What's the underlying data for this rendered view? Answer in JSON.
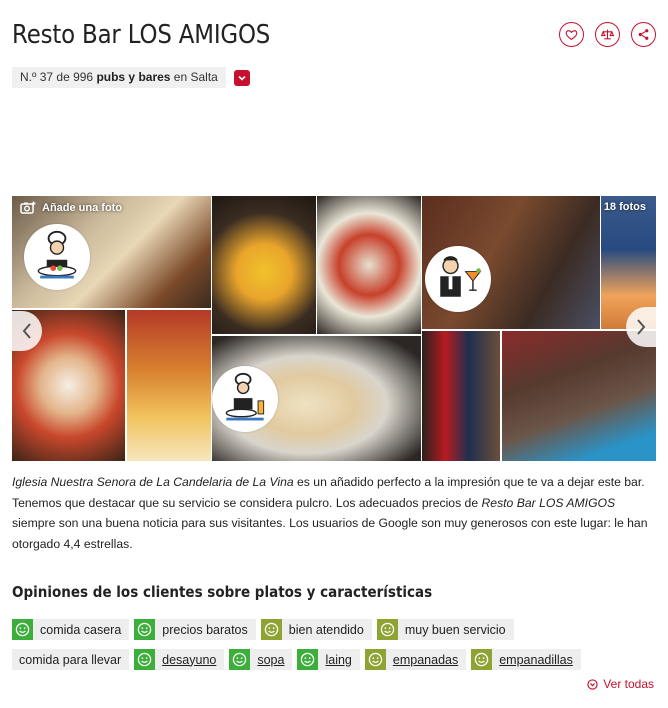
{
  "header": {
    "title": "Resto Bar LOS AMIGOS",
    "actions": [
      {
        "name": "heart-icon",
        "label": "favorite"
      },
      {
        "name": "scales-icon",
        "label": "compare"
      },
      {
        "name": "share-icon",
        "label": "share"
      }
    ]
  },
  "ranking": {
    "prefix": "N.º 37 de 996 ",
    "category": "pubs y bares",
    "suffix": " en Salta",
    "dropdown_icon": "chevron-down-icon"
  },
  "gallery": {
    "add_photo": "Añade una foto",
    "photo_count": "18 fotos",
    "prev_icon": "chevron-left-icon",
    "next_icon": "chevron-right-icon"
  },
  "description": {
    "place": "Iglesia Nuestra Senora de La Candelaria de La Vina",
    "text1": " es un añadido perfecto a la impresión que te va a dejar este bar. Tenemos que destacar que su servicio se considera pulcro. Los adecuados precios de ",
    "restaurant": "Resto Bar LOS AMIGOS",
    "text2": " siempre son una buena noticia para sus visitantes. Los usuarios de Google son muy generosos con este lugar: le han otorgado 4,4 estrellas."
  },
  "opinions": {
    "title": "Opiniones de los clientes sobre platos y características",
    "row1": [
      {
        "label": "comida casera",
        "sentiment": "green",
        "underlined": false
      },
      {
        "label": "precios baratos",
        "sentiment": "green",
        "underlined": false
      },
      {
        "label": "bien atendido",
        "sentiment": "olive",
        "underlined": false
      },
      {
        "label": "muy buen servicio",
        "sentiment": "olive",
        "underlined": false
      }
    ],
    "row2": [
      {
        "label": "comida para llevar",
        "sentiment": "none",
        "underlined": false
      },
      {
        "label": "desayuno",
        "sentiment": "green",
        "underlined": true
      },
      {
        "label": "sopa",
        "sentiment": "green",
        "underlined": true
      },
      {
        "label": "laing",
        "sentiment": "green",
        "underlined": true
      },
      {
        "label": "empanadas",
        "sentiment": "olive",
        "underlined": true
      },
      {
        "label": "empanadillas",
        "sentiment": "olive",
        "underlined": true
      }
    ],
    "see_all": "Ver todas"
  },
  "colors": {
    "brand": "#c8102e",
    "positive": "#3cae3a",
    "neutral_positive": "#8da332",
    "tag_bg": "#eeeeee"
  }
}
